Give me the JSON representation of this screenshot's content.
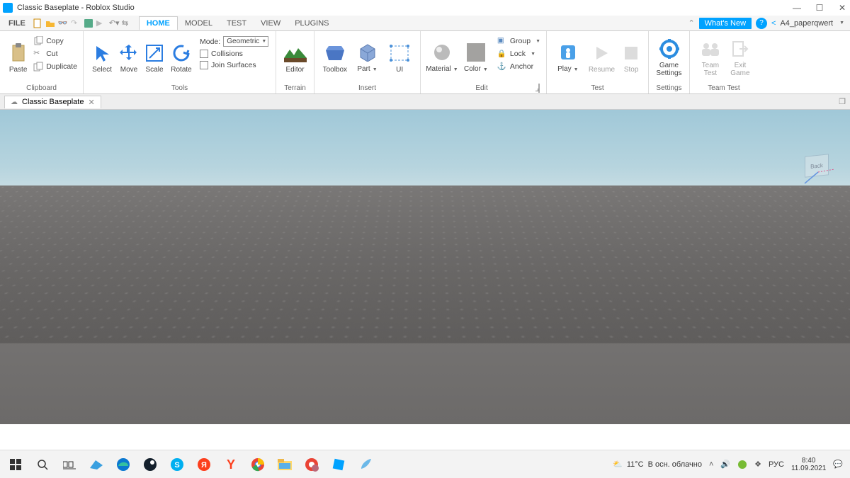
{
  "titlebar": {
    "title": "Classic Baseplate - Roblox Studio"
  },
  "quick_access": {
    "file_label": "FILE"
  },
  "tabs": {
    "home": "HOME",
    "model": "MODEL",
    "test": "TEST",
    "view": "VIEW",
    "plugins": "PLUGINS"
  },
  "header_right": {
    "whats_new": "What's New",
    "share_icon": "share-icon",
    "username": "A4_paperqwert"
  },
  "ribbon": {
    "clipboard": {
      "group_label": "Clipboard",
      "paste": "Paste",
      "copy": "Copy",
      "cut": "Cut",
      "duplicate": "Duplicate"
    },
    "tools": {
      "group_label": "Tools",
      "select": "Select",
      "move": "Move",
      "scale": "Scale",
      "rotate": "Rotate",
      "mode_label": "Mode:",
      "mode_value": "Geometric",
      "collisions": "Collisions",
      "join_surfaces": "Join Surfaces"
    },
    "terrain": {
      "group_label": "Terrain",
      "editor": "Editor"
    },
    "insert": {
      "group_label": "Insert",
      "toolbox": "Toolbox",
      "part": "Part",
      "ui": "UI"
    },
    "edit": {
      "group_label": "Edit",
      "material": "Material",
      "color": "Color",
      "group": "Group",
      "lock": "Lock",
      "anchor": "Anchor"
    },
    "test": {
      "group_label": "Test",
      "play": "Play",
      "resume": "Resume",
      "stop": "Stop"
    },
    "settings": {
      "group_label": "Settings",
      "game_settings_l1": "Game",
      "game_settings_l2": "Settings"
    },
    "team": {
      "group_label": "Team Test",
      "team_test_l1": "Team",
      "team_test_l2": "Test",
      "exit_l1": "Exit",
      "exit_l2": "Game"
    }
  },
  "doc_tab": {
    "name": "Classic Baseplate"
  },
  "orientation_widget": {
    "face": "Back"
  },
  "taskbar": {
    "weather_temp": "11°C",
    "weather_text": "В осн. облачно",
    "lang": "РУС",
    "time": "8:40",
    "date": "11.09.2021"
  }
}
